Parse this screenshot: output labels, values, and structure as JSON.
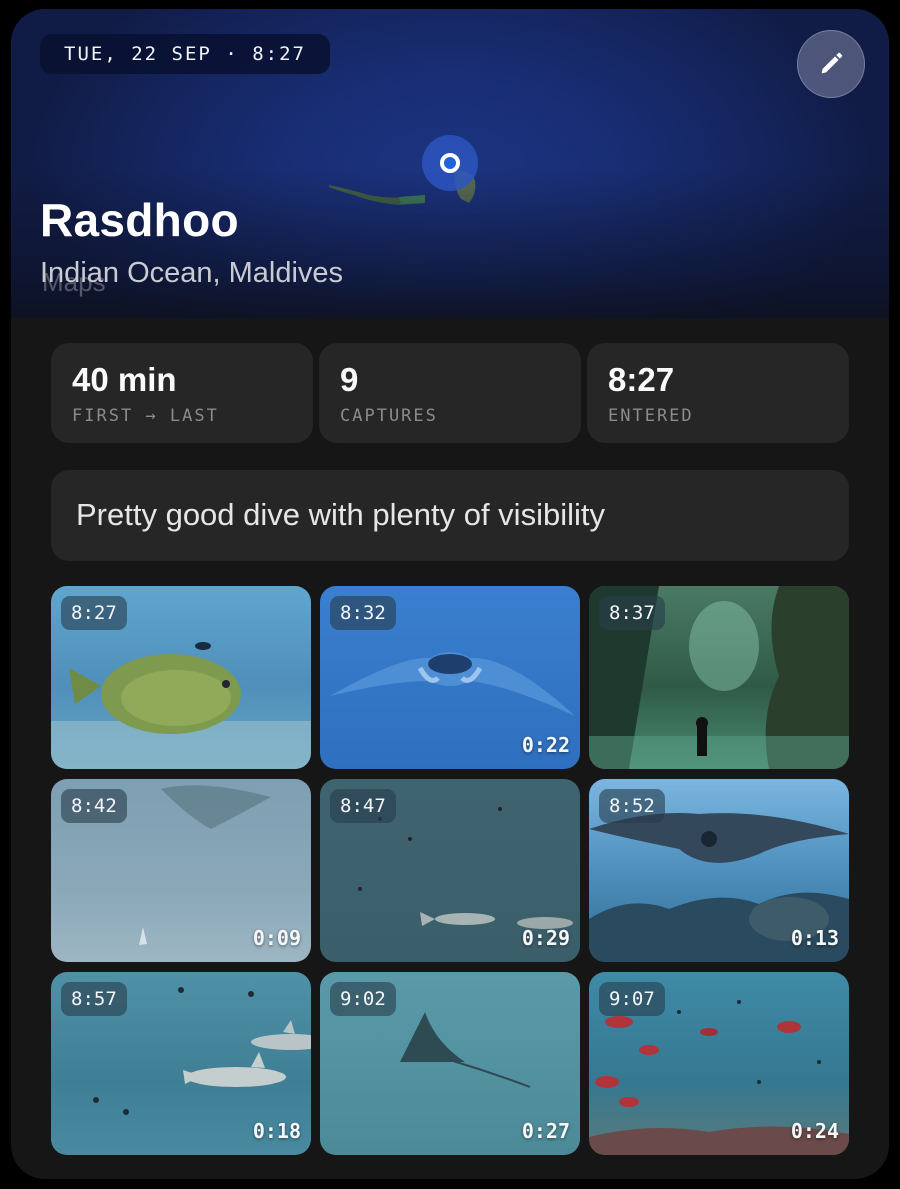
{
  "header": {
    "date_chip": "TUE, 22 SEP · 8:27",
    "title": "Rasdhoo",
    "subtitle": "Indian Ocean, Maldives",
    "map_watermark": "Maps",
    "edit_icon": "pencil-icon",
    "pin_icon": "location-pin-icon"
  },
  "stats": [
    {
      "value": "40 min",
      "label": "FIRST → LAST"
    },
    {
      "value": "9",
      "label": "CAPTURES"
    },
    {
      "value": "8:27",
      "label": "ENTERED"
    }
  ],
  "note": "Pretty good dive with plenty of visibility",
  "captures": [
    {
      "time": "8:27",
      "duration": "",
      "scene": "napoleon-wrasse"
    },
    {
      "time": "8:32",
      "duration": "0:22",
      "scene": "manta-ray-overhead"
    },
    {
      "time": "8:37",
      "duration": "",
      "scene": "diver-in-cave"
    },
    {
      "time": "8:42",
      "duration": "0:09",
      "scene": "murky-ray"
    },
    {
      "time": "8:47",
      "duration": "0:29",
      "scene": "sharks-over-reef"
    },
    {
      "time": "8:52",
      "duration": "0:13",
      "scene": "manta-over-coral"
    },
    {
      "time": "8:57",
      "duration": "0:18",
      "scene": "reef-sharks"
    },
    {
      "time": "9:02",
      "duration": "0:27",
      "scene": "eagle-ray"
    },
    {
      "time": "9:07",
      "duration": "0:24",
      "scene": "red-fish-school"
    }
  ],
  "colors": {
    "background": "#000000",
    "card": "#161616",
    "stat_card": "#262626",
    "map_blue": "#182d74",
    "pin_blue": "#1e63d8"
  }
}
